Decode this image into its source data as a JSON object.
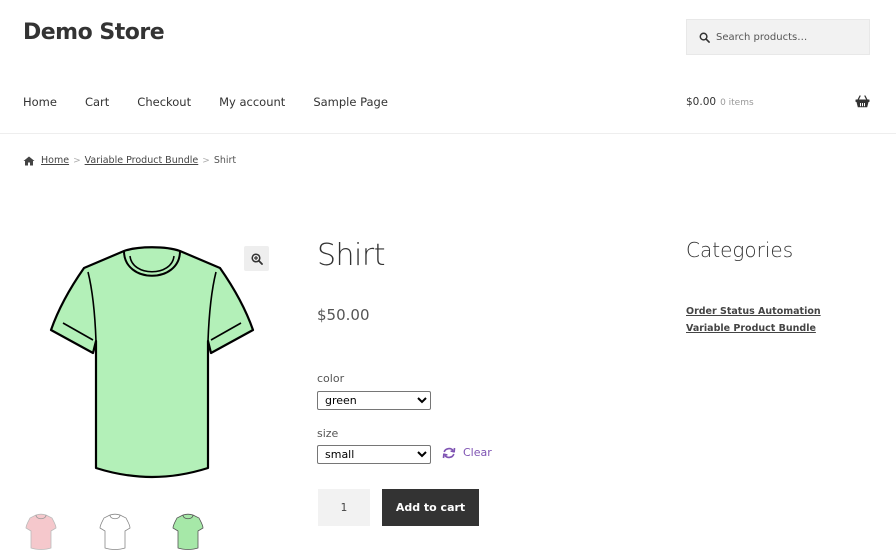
{
  "header": {
    "site_title": "Demo Store",
    "search_placeholder": "Search products…"
  },
  "nav": {
    "items": [
      "Home",
      "Cart",
      "Checkout",
      "My account",
      "Sample Page"
    ]
  },
  "cart": {
    "total": "$0.00",
    "items": "0 items"
  },
  "breadcrumb": {
    "home": "Home",
    "category": "Variable Product Bundle",
    "separator": ">",
    "current": "Shirt"
  },
  "product": {
    "title": "Shirt",
    "price": "$50.00",
    "attributes": {
      "color_label": "color",
      "color_value": "green",
      "size_label": "size",
      "size_value": "small"
    },
    "clear_label": "Clear",
    "quantity": "1",
    "add_to_cart_label": "Add to cart",
    "image_color": "#b3f0b8",
    "thumb_colors": [
      "#f5c8cc",
      "#ffffff",
      "#a6e8a8"
    ]
  },
  "sidebar": {
    "widget_title": "Categories",
    "categories": [
      "Order Status Automation",
      "Variable Product Bundle"
    ]
  },
  "icons": {
    "search": "search-icon",
    "basket": "basket-icon",
    "home": "home-icon",
    "zoom": "zoom-icon",
    "refresh": "refresh-icon"
  }
}
